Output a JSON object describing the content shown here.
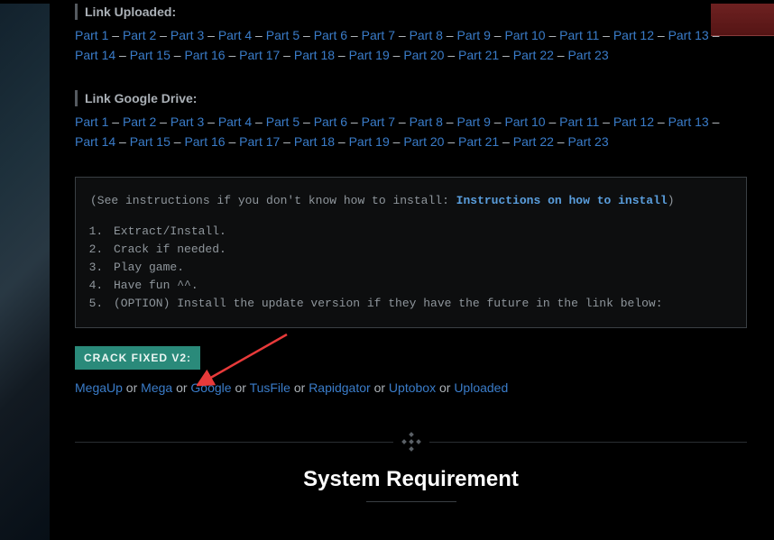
{
  "sections": {
    "uploaded": {
      "label": "Link Uploaded:",
      "parts": [
        "Part 1",
        "Part 2",
        "Part 3",
        "Part 4",
        "Part 5",
        "Part 6",
        "Part 7",
        "Part 8",
        "Part 9",
        "Part 10",
        "Part 11",
        "Part 12",
        "Part 13",
        "Part 14",
        "Part 15",
        "Part 16",
        "Part 17",
        "Part 18",
        "Part 19",
        "Part 20",
        "Part 21",
        "Part 22",
        "Part 23"
      ]
    },
    "googledrive": {
      "label": "Link Google Drive:",
      "parts": [
        "Part 1",
        "Part 2",
        "Part 3",
        "Part 4",
        "Part 5",
        "Part 6",
        "Part 7",
        "Part 8",
        "Part 9",
        "Part 10",
        "Part 11",
        "Part 12",
        "Part 13",
        "Part 14",
        "Part 15",
        "Part 16",
        "Part 17",
        "Part 18",
        "Part 19",
        "Part 20",
        "Part 21",
        "Part 22",
        "Part 23"
      ]
    }
  },
  "instructions": {
    "prefix": "(See instructions if you don't know how to install: ",
    "link_text": "Instructions on how to install",
    "suffix": ")",
    "steps": [
      "Extract/Install.",
      "Crack if needed.",
      "Play game.",
      "Have fun ^^.",
      "(OPTION) Install the update version if they have the future in the link below:"
    ]
  },
  "crack": {
    "label": "CRACK FIXED V2:",
    "links": [
      "MegaUp",
      "Mega",
      "Google",
      "TusFile",
      "Rapidgator",
      "Uptobox",
      "Uploaded"
    ],
    "separator": " or "
  },
  "separator_glyph": " – ",
  "system_requirement_heading": "System Requirement"
}
